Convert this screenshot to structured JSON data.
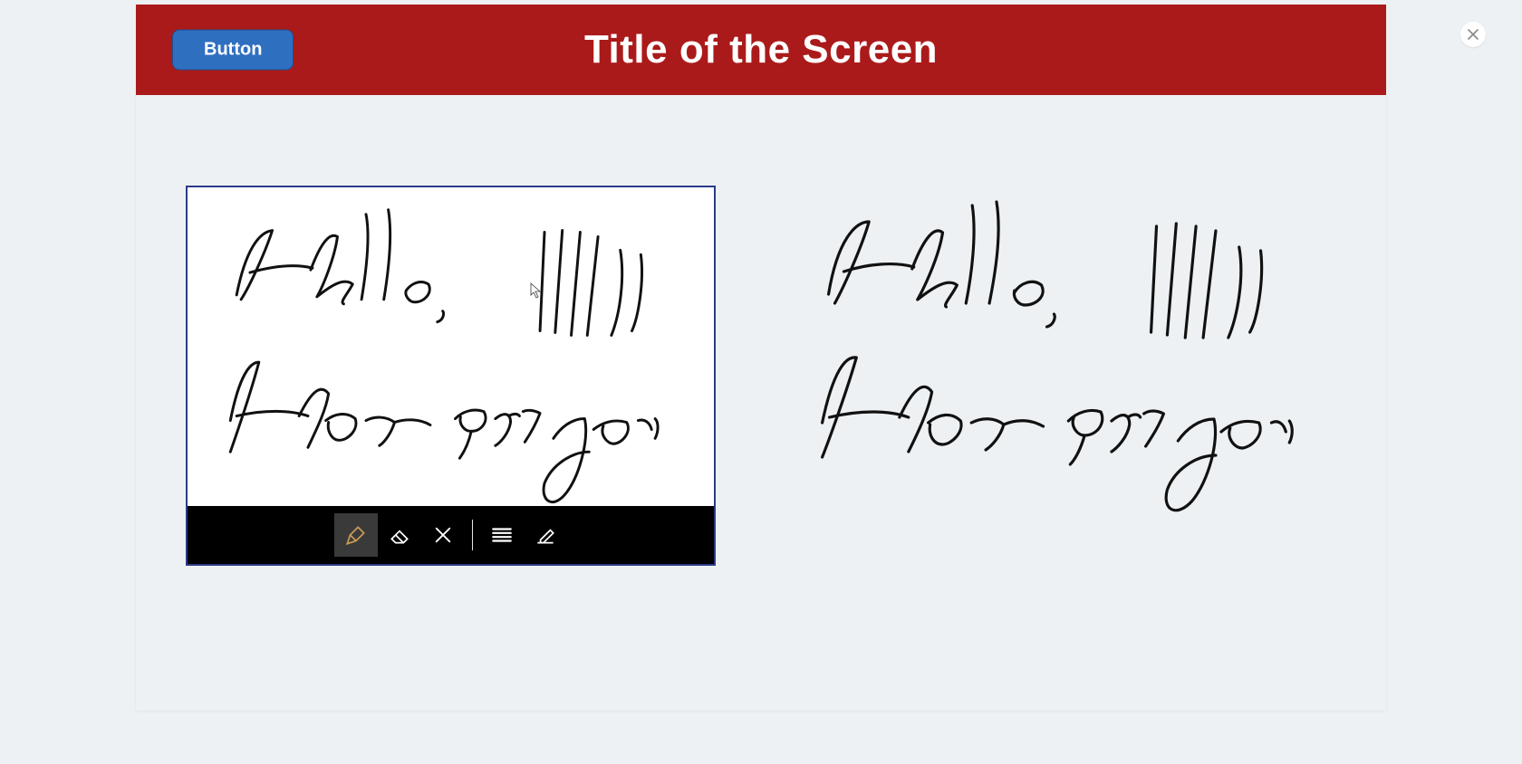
{
  "header": {
    "title": "Title of the Screen",
    "button_label": "Button"
  },
  "close_icon_name": "close-icon",
  "signature": {
    "line1": "Hello,",
    "line2": "How are you"
  },
  "toolbar": {
    "items": [
      {
        "name": "pen-tool-icon",
        "active": true
      },
      {
        "name": "eraser-tool-icon",
        "active": false
      },
      {
        "name": "clear-tool-icon",
        "active": false
      },
      {
        "separator": true
      },
      {
        "name": "lines-tool-icon",
        "active": false
      },
      {
        "name": "edit-tool-icon",
        "active": false
      }
    ]
  },
  "colors": {
    "header_bg": "#ab1a1a",
    "button_bg": "#2f6fc0",
    "canvas_border": "#2a3a8a",
    "toolbar_bg": "#000000",
    "active_tool": "#c89a57",
    "page_bg": "#eef1f3"
  }
}
